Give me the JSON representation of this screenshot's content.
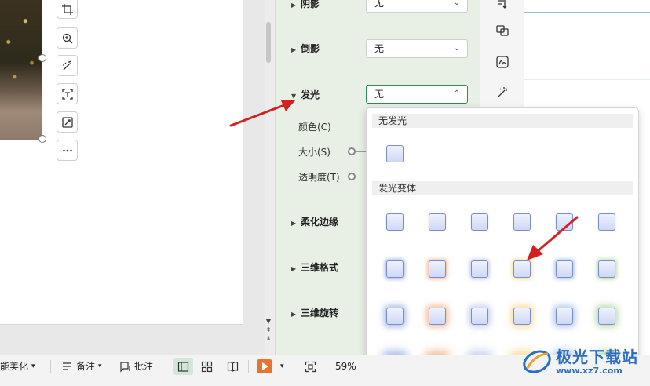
{
  "pane": {
    "shadow_label": "阴影",
    "shadow_value": "无",
    "reflection_label": "倒影",
    "reflection_value": "无",
    "glow_label": "发光",
    "glow_value": "无",
    "color_label": "颜色(C)",
    "size_label": "大小(S)",
    "transparency_label": "透明度(T)",
    "soft_edges_label": "柔化边缘",
    "format_3d_label": "三维格式",
    "rotation_3d_label": "三维旋转"
  },
  "glow_dropdown": {
    "no_glow_header": "无发光",
    "variants_header": "发光变体",
    "variant_colors": [
      "#6f8fd6",
      "#e8935a",
      "#a7b3dd",
      "#f0c85a",
      "#7fa6e0",
      "#8cc67a"
    ]
  },
  "status_bar": {
    "beautify_label": "能美化",
    "notes_label": "备注",
    "comments_label": "批注",
    "zoom": "59%"
  },
  "watermark": {
    "title": "极光下载站",
    "url": "www.xz7.com"
  },
  "colors": {
    "pane_bg": "#e8f0e6",
    "accent_green": "#2e8b57",
    "arrow_red": "#d42020",
    "play_orange": "#e8742a"
  }
}
